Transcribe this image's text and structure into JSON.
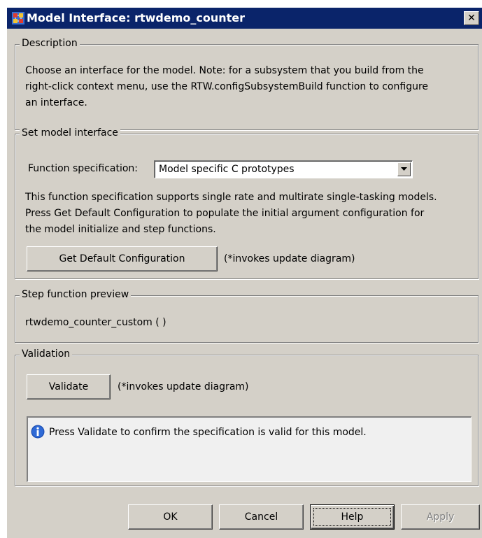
{
  "window": {
    "title": "Model Interface: rtwdemo_counter",
    "close_label": "✕"
  },
  "description": {
    "legend": "Description",
    "lines": [
      "Choose an interface for the model. Note: for a subsystem that you build from the",
      "right-click context menu, use the RTW.configSubsystemBuild function to configure",
      "an interface."
    ]
  },
  "set_interface": {
    "legend": "Set model interface",
    "function_spec_label": "Function specification:",
    "function_spec_value": "Model specific C prototypes",
    "help_lines": [
      "This function specification supports single rate and multirate single-tasking models.",
      "Press Get Default Configuration to populate the initial argument configuration for",
      "the model initialize and step functions."
    ],
    "get_default_button": "Get Default Configuration",
    "get_default_note": "(*invokes update diagram)"
  },
  "step_preview": {
    "legend": "Step function preview",
    "text": "rtwdemo_counter_custom ( )"
  },
  "validation": {
    "legend": "Validation",
    "validate_button": "Validate",
    "validate_note": "(*invokes update diagram)",
    "message": "Press Validate to confirm the specification is valid for this model."
  },
  "footer": {
    "ok": "OK",
    "cancel": "Cancel",
    "help": "Help",
    "apply": "Apply"
  },
  "colors": {
    "titlebar": "#0a246a",
    "dialog_bg": "#d4d0c8",
    "info_icon": "#1e50b4"
  }
}
